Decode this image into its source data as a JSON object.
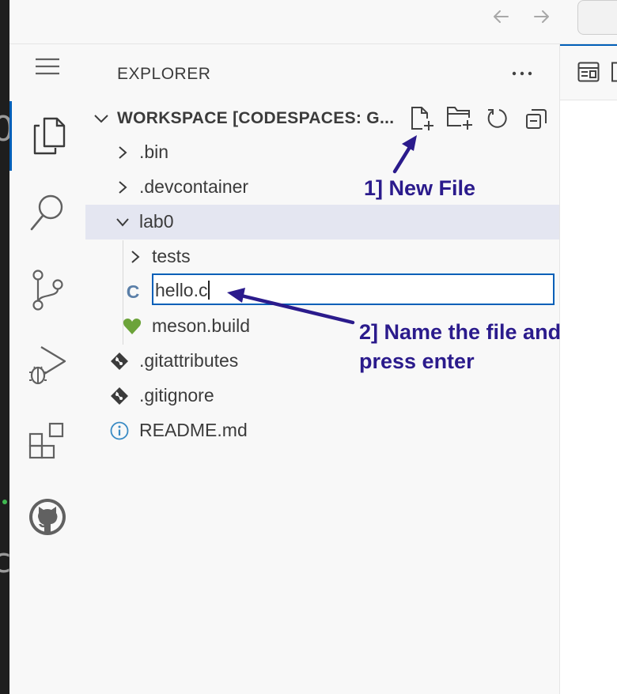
{
  "titlebar": {
    "back_icon": "arrow-left-icon",
    "forward_icon": "arrow-right-icon"
  },
  "left_strip": {
    "fragment_top": "0",
    "fragment_bottom": "c"
  },
  "activity_bar": {
    "menu_icon": "hamburger-menu-icon",
    "items": [
      {
        "name": "explorer",
        "icon": "files-icon",
        "active": true
      },
      {
        "name": "search",
        "icon": "search-icon",
        "active": false
      },
      {
        "name": "source-control",
        "icon": "source-control-icon",
        "active": false
      },
      {
        "name": "run-and-debug",
        "icon": "run-debug-icon",
        "active": false
      },
      {
        "name": "extensions",
        "icon": "extensions-icon",
        "active": false
      },
      {
        "name": "github",
        "icon": "github-icon",
        "active": false
      }
    ]
  },
  "explorer": {
    "title": "EXPLORER",
    "more_icon": "ellipsis-icon",
    "workspace": {
      "title": "WORKSPACE [CODESPACES: G...",
      "actions": [
        "new-file-icon",
        "new-folder-icon",
        "refresh-icon",
        "collapse-all-icon"
      ]
    },
    "tree": [
      {
        "label": ".bin",
        "type": "folder",
        "expanded": false,
        "level": 0
      },
      {
        "label": ".devcontainer",
        "type": "folder",
        "expanded": false,
        "level": 0
      },
      {
        "label": "lab0",
        "type": "folder",
        "expanded": true,
        "level": 0,
        "selected": true
      },
      {
        "label": "tests",
        "type": "folder",
        "expanded": false,
        "level": 1
      },
      {
        "label": "hello.c",
        "type": "rename-input",
        "icon": "c-file-icon",
        "level": 1
      },
      {
        "label": "meson.build",
        "type": "file",
        "icon": "meson-heart-icon",
        "level": 1
      },
      {
        "label": ".gitattributes",
        "type": "file",
        "icon": "git-icon",
        "level": 0
      },
      {
        "label": ".gitignore",
        "type": "file",
        "icon": "git-icon",
        "level": 0
      },
      {
        "label": "README.md",
        "type": "file",
        "icon": "info-icon",
        "level": 0
      }
    ],
    "rename_value": "hello.c",
    "c_icon_glyph": "C"
  },
  "annotations": {
    "step1": "1] New File",
    "step2_line1": "2] Name the file and",
    "step2_line2": "press enter",
    "color": "#2b1b8c"
  },
  "colors": {
    "accent": "#005fb8",
    "selected_row": "#e4e6f1",
    "c_icon": "#5a7fa8",
    "meson_heart": "#6ca33a",
    "git_icon": "#3b3b3b",
    "info_icon": "#3a8bc4"
  }
}
